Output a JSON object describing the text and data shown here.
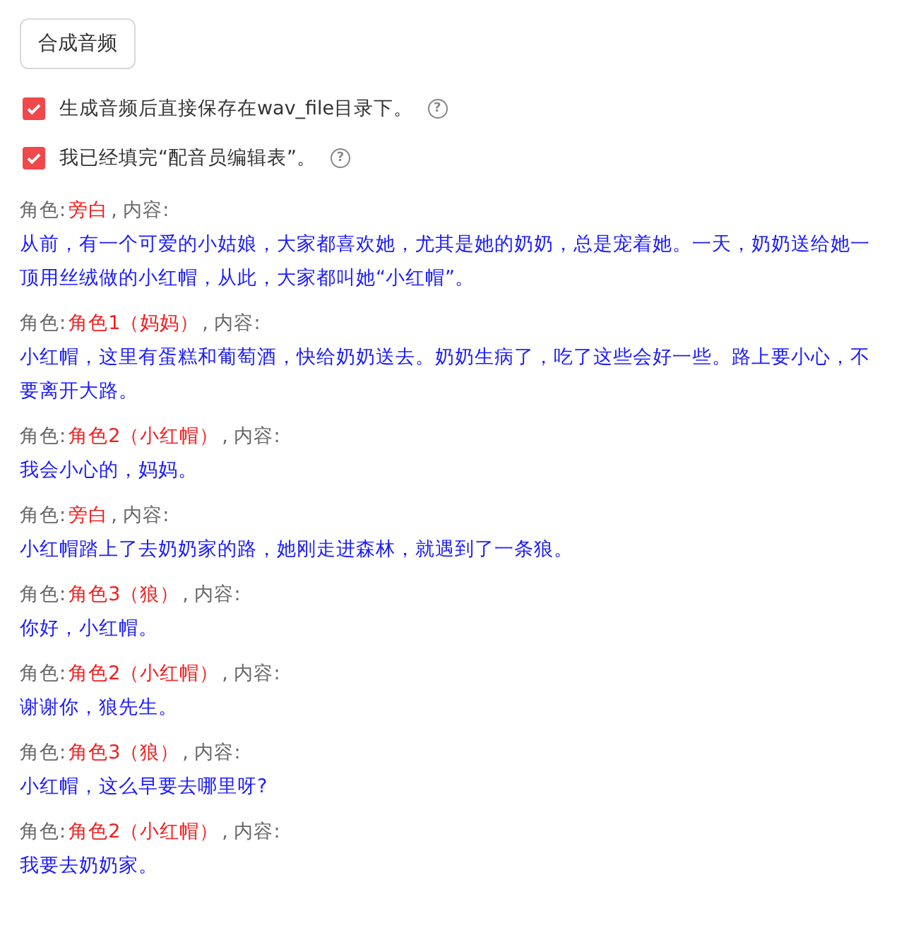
{
  "button": "合成音频",
  "options": [
    {
      "label": "生成音频后直接保存在wav_file目录下。",
      "checked": true,
      "help": "?"
    },
    {
      "label": "我已经填完“配音员编辑表”。",
      "checked": true,
      "help": "?"
    }
  ],
  "lines": [
    {
      "label": "角色:",
      "role": "旁白",
      "separator": ", 内容:",
      "content": "从前，有一个可爱的小姑娘，大家都喜欢她，尤其是她的奶奶，总是宠着她。一天，奶奶送给她一顶用丝绒做的小红帽，从此，大家都叫她“小红帽”。"
    },
    {
      "label": "角色:",
      "role": "角色1（妈妈）",
      "separator": ", 内容:",
      "content": "小红帽，这里有蛋糕和葡萄酒，快给奶奶送去。奶奶生病了，吃了这些会好一些。路上要小心，不要离开大路。"
    },
    {
      "label": "角色:",
      "role": "角色2（小红帽）",
      "separator": ", 内容:",
      "content": "我会小心的，妈妈。"
    },
    {
      "label": "角色:",
      "role": "旁白",
      "separator": ", 内容:",
      "content": "小红帽踏上了去奶奶家的路，她刚走进森林，就遇到了一条狼。"
    },
    {
      "label": "角色:",
      "role": "角色3（狼）",
      "separator": ", 内容:",
      "content": "你好，小红帽。"
    },
    {
      "label": "角色:",
      "role": "角色2（小红帽）",
      "separator": ", 内容:",
      "content": "谢谢你，狼先生。"
    },
    {
      "label": "角色:",
      "role": "角色3（狼）",
      "separator": ", 内容:",
      "content": "小红帽，这么早要去哪里呀?"
    },
    {
      "label": "角色:",
      "role": "角色2（小红帽）",
      "separator": ", 内容:",
      "content": "我要去奶奶家。"
    }
  ]
}
